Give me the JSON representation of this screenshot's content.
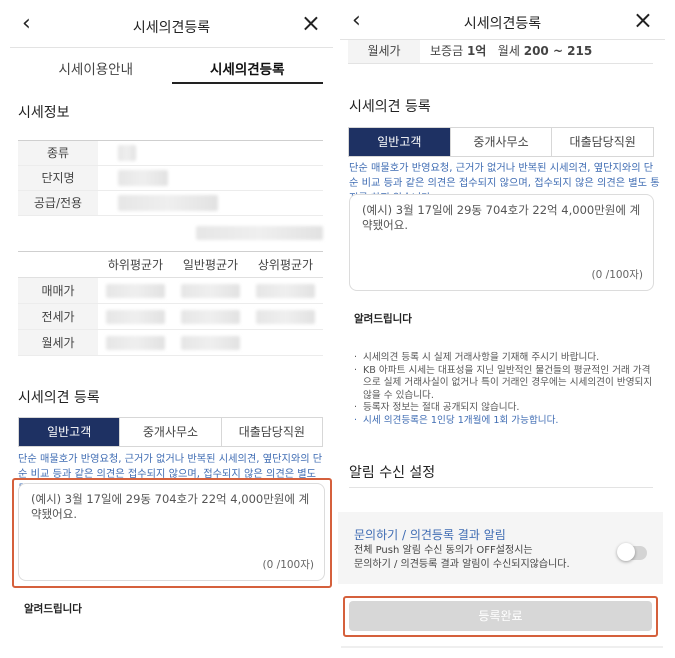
{
  "left": {
    "header": {
      "back_icon": "chevron-left-icon",
      "title": "시세의견등록",
      "close_icon": "close-icon"
    },
    "tabs": [
      {
        "label": "시세이용안내",
        "active": false
      },
      {
        "label": "시세의견등록",
        "active": true
      }
    ],
    "info": {
      "title": "시세정보",
      "rows": [
        {
          "label": "종류"
        },
        {
          "label": "단지명"
        },
        {
          "label": "공급/전용"
        }
      ]
    },
    "price_table": {
      "headers": [
        "하위평균가",
        "일반평균가",
        "상위평균가"
      ],
      "rows": [
        {
          "label": "매매가"
        },
        {
          "label": "전세가"
        },
        {
          "label": "월세가"
        }
      ]
    },
    "opinion": {
      "title": "시세의견 등록",
      "segments": [
        "일반고객",
        "중개사무소",
        "대출담당직원"
      ],
      "active_segment": 0,
      "notice": "단순 매물호가 반영요청, 근거가 없거나 반복된 시세의견, 옆단지와의 단순 비교 등과 같은 의견은 접수되지 않으며, 접수되지 않은 의견은 별도 통지를 하지 않습니다.",
      "placeholder": "(예시) 3월 17일에 29동 704호가 22억 4,000만원에 계약됐어요.",
      "counter": "(0 /100자)"
    },
    "notice_label": "알려드립니다"
  },
  "right": {
    "header": {
      "back_icon": "chevron-left-icon",
      "title": "시세의견등록",
      "close_icon": "close-icon"
    },
    "monthly_row": {
      "label": "월세가",
      "deposit_label": "보증금",
      "deposit_value": "1억",
      "rent_label": "월세",
      "rent_value": "200 ~ 215"
    },
    "opinion": {
      "title": "시세의견 등록",
      "segments": [
        "일반고객",
        "중개사무소",
        "대출담당직원"
      ],
      "active_segment": 0,
      "notice": "단순 매물호가 반영요청, 근거가 없거나 반복된 시세의견, 옆단지와의 단순 비교 등과 같은 의견은 접수되지 않으며, 접수되지 않은 의견은 별도 통지를 하지 않습니다.",
      "placeholder": "(예시) 3월 17일에 29동 704호가 22억 4,000만원에 계약됐어요.",
      "counter": "(0 /100자)"
    },
    "notice_label": "알려드립니다",
    "bullets": [
      {
        "text": "시세의견 등록 시 실제 거래사항을 기재해 주시기 바랍니다.",
        "highlight": false
      },
      {
        "text": "KB 아파트 시세는 대표성을 지닌 일반적인 물건들의 평균적인 거래 가격으로 실제 거래사실이 없거나 특이 거래인 경우에는 시세의견이 반영되지 않을 수 있습니다.",
        "highlight": false
      },
      {
        "text": "등록자 정보는 절대 공개되지 않습니다.",
        "highlight": false
      },
      {
        "text": "시세 의견등록은 1인당 1개월에 1회 가능합니다.",
        "highlight": true
      }
    ],
    "alert": {
      "title": "알림 수신 설정",
      "item_title": "문의하기 / 의견등록 결과 알림",
      "item_desc_1": "전체 Push 알림 수신 동의가 OFF설정시는",
      "item_desc_2": "문의하기 / 의견등록 결과 알림이 수신되지않습니다.",
      "toggle_on": false
    },
    "submit_label": "등록완료"
  },
  "colors": {
    "accent_navy": "#1e3163",
    "link_blue": "#3f6cb3",
    "highlight_orange": "#d5603c",
    "disabled_gray": "#d7d7d7"
  }
}
